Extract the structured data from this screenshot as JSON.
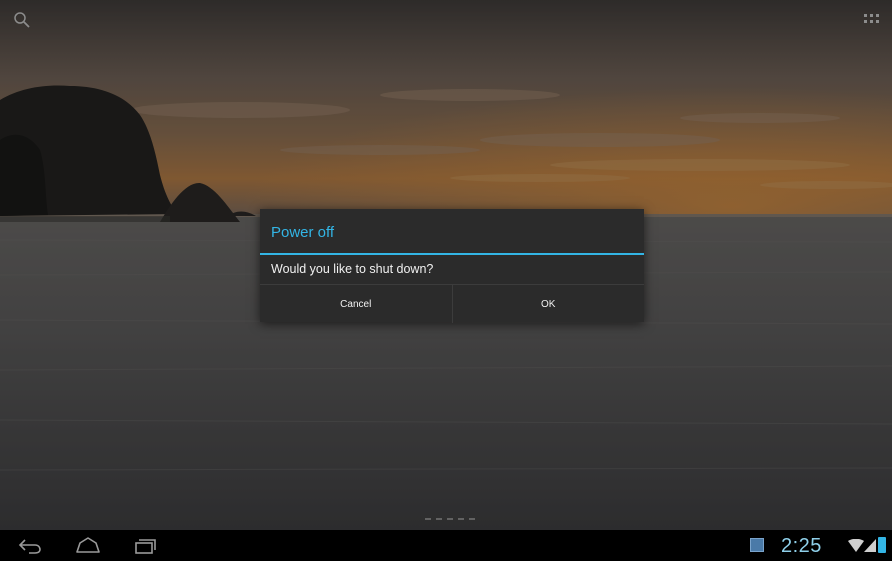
{
  "dialog": {
    "title": "Power off",
    "message": "Would you like to shut down?",
    "cancel_label": "Cancel",
    "ok_label": "OK"
  },
  "status_bar": {
    "time": "2:25"
  },
  "icons": {
    "search": "search-icon",
    "apps": "all-apps-grid-icon",
    "back": "back-arrow-icon",
    "home": "home-icon",
    "recent": "recent-apps-icon",
    "notification": "notification-icon",
    "wifi": "wifi-icon",
    "signal": "cell-signal-icon",
    "battery": "battery-icon"
  },
  "colors": {
    "accent": "#33b5e5",
    "dialog_bg": "#2b2b2b",
    "clock": "#8fd0ea"
  }
}
